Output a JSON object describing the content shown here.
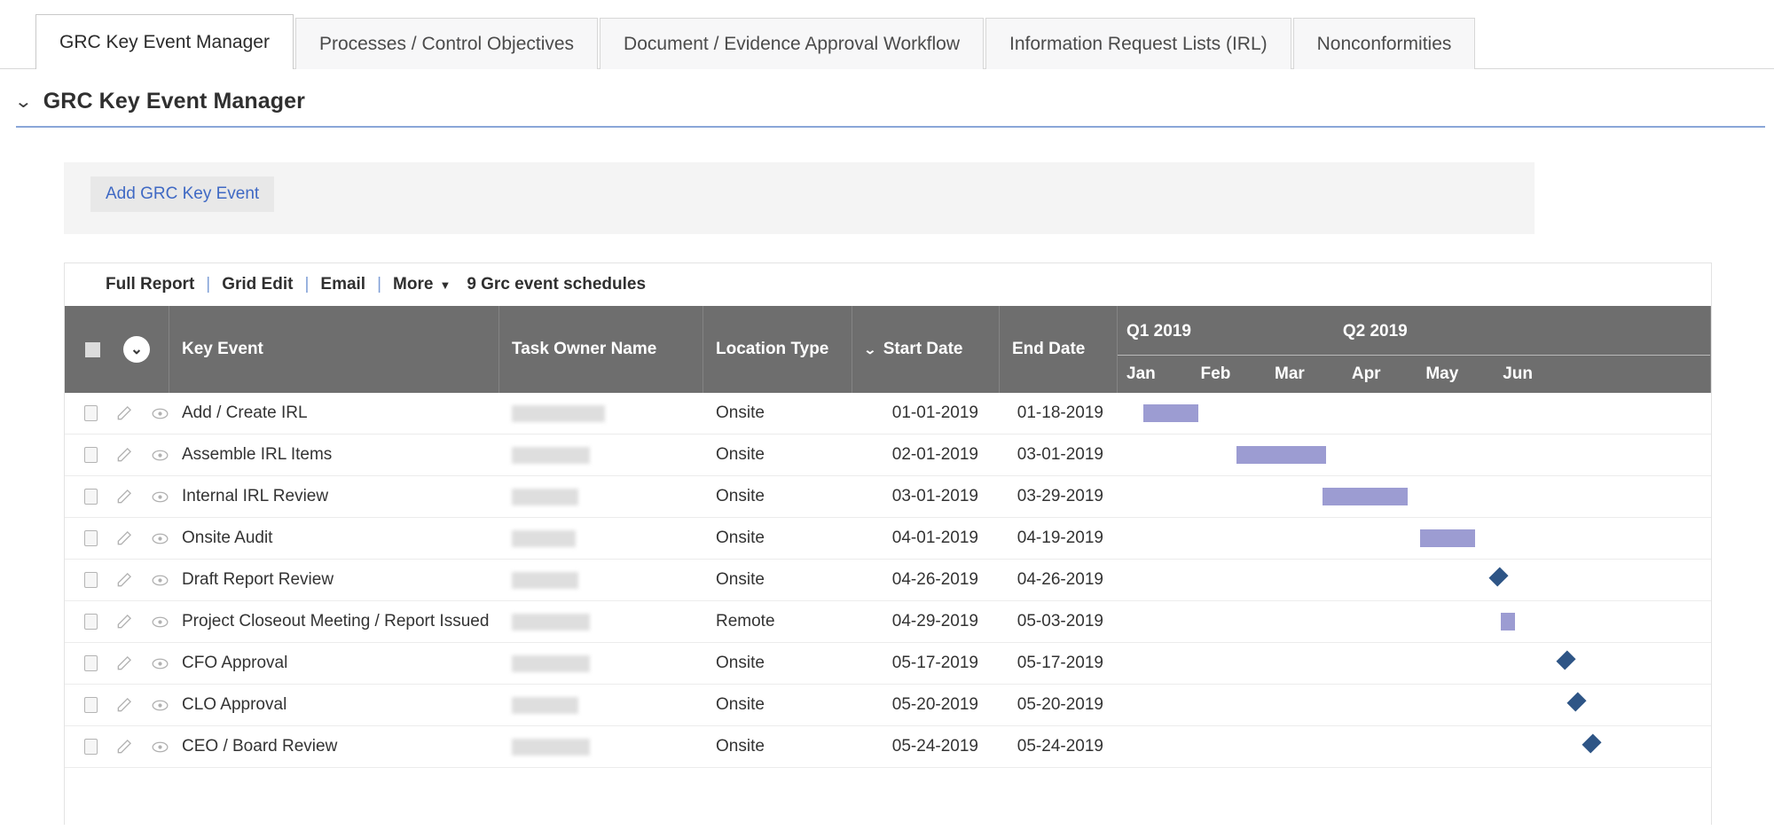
{
  "tabs": [
    {
      "label": "GRC Key Event Manager",
      "active": true
    },
    {
      "label": "Processes / Control Objectives",
      "active": false
    },
    {
      "label": "Document / Evidence Approval Workflow",
      "active": false
    },
    {
      "label": "Information Request Lists (IRL)",
      "active": false
    },
    {
      "label": "Nonconformities",
      "active": false
    }
  ],
  "section": {
    "title": "GRC Key Event Manager",
    "collapse_icon": "chevron-down-icon"
  },
  "add_panel": {
    "button_label": "Add  GRC Key Event"
  },
  "toolbar": {
    "full_report": "Full Report",
    "grid_edit": "Grid Edit",
    "email": "Email",
    "more": "More",
    "more_caret": "▼",
    "separator": "|",
    "record_count": "9 Grc event schedules"
  },
  "grid": {
    "header": {
      "select_all_icon": "checkbox-icon",
      "menu_icon": "chevron-down-circle-icon",
      "key_event": "Key Event",
      "task_owner_name": "Task Owner Name",
      "location_type": "Location Type",
      "start_date": "Start Date",
      "start_date_sort_icon": "sort-chevron-down-icon",
      "end_date": "End Date"
    },
    "rows": [
      {
        "key_event": "Add / Create IRL",
        "task_owner_name": "",
        "location_type": "Onsite",
        "start_date": "01-01-2019",
        "end_date": "01-18-2019"
      },
      {
        "key_event": "Assemble IRL Items",
        "task_owner_name": "",
        "location_type": "Onsite",
        "start_date": "02-01-2019",
        "end_date": "03-01-2019"
      },
      {
        "key_event": "Internal IRL Review",
        "task_owner_name": "",
        "location_type": "Onsite",
        "start_date": "03-01-2019",
        "end_date": "03-29-2019"
      },
      {
        "key_event": "Onsite Audit",
        "task_owner_name": "",
        "location_type": "Onsite",
        "start_date": "04-01-2019",
        "end_date": "04-19-2019"
      },
      {
        "key_event": "Draft Report Review",
        "task_owner_name": "",
        "location_type": "Onsite",
        "start_date": "04-26-2019",
        "end_date": "04-26-2019"
      },
      {
        "key_event": "Project Closeout Meeting / Report Issued",
        "task_owner_name": "",
        "location_type": "Remote",
        "start_date": "04-29-2019",
        "end_date": "05-03-2019"
      },
      {
        "key_event": "CFO Approval",
        "task_owner_name": "",
        "location_type": "Onsite",
        "start_date": "05-17-2019",
        "end_date": "05-17-2019"
      },
      {
        "key_event": "CLO Approval",
        "task_owner_name": "",
        "location_type": "Onsite",
        "start_date": "05-20-2019",
        "end_date": "05-20-2019"
      },
      {
        "key_event": "CEO / Board Review",
        "task_owner_name": "",
        "location_type": "Onsite",
        "start_date": "05-24-2019",
        "end_date": "05-24-2019"
      }
    ]
  },
  "chart_data": {
    "type": "bar",
    "title": "GRC Key Event Manager Gantt Timeline",
    "subtitle": "",
    "xlabel": "",
    "ylabel": "",
    "grid": false,
    "legend_position": "none",
    "quarters": [
      {
        "label": "Q1 2019",
        "left_pct": 1.5
      },
      {
        "label": "Q2 2019",
        "left_pct": 38.0
      }
    ],
    "months": [
      {
        "label": "Jan",
        "left_pct": 1.5
      },
      {
        "label": "Feb",
        "left_pct": 14.0
      },
      {
        "label": "Mar",
        "left_pct": 26.5
      },
      {
        "label": "Apr",
        "left_pct": 39.5
      },
      {
        "label": "May",
        "left_pct": 52.0
      },
      {
        "label": "Jun",
        "left_pct": 65.0
      }
    ],
    "axis_range": [
      "2019-01-01",
      "2019-06-30"
    ],
    "bars": [
      {
        "task": "Add / Create IRL",
        "start": "01-01-2019",
        "end": "01-18-2019",
        "shape": "bar",
        "left_pct": 4.3,
        "width_pct": 9.3,
        "color": "#9c9cd2"
      },
      {
        "task": "Assemble IRL Items",
        "start": "02-01-2019",
        "end": "03-01-2019",
        "shape": "bar",
        "left_pct": 20.0,
        "width_pct": 15.2,
        "color": "#9c9cd2"
      },
      {
        "task": "Internal IRL Review",
        "start": "03-01-2019",
        "end": "03-29-2019",
        "shape": "bar",
        "left_pct": 34.6,
        "width_pct": 14.3,
        "color": "#9c9cd2"
      },
      {
        "task": "Onsite Audit",
        "start": "04-01-2019",
        "end": "04-19-2019",
        "shape": "bar",
        "left_pct": 50.9,
        "width_pct": 9.4,
        "color": "#9c9cd2"
      },
      {
        "task": "Draft Report Review",
        "start": "04-26-2019",
        "end": "04-26-2019",
        "shape": "milestone",
        "left_pct": 63.1,
        "width_pct": 0,
        "color": "#2e5586"
      },
      {
        "task": "Project Closeout Meeting / Report Issued",
        "start": "04-29-2019",
        "end": "05-03-2019",
        "shape": "bar",
        "left_pct": 64.5,
        "width_pct": 2.4,
        "color": "#9c9cd2"
      },
      {
        "task": "CFO Approval",
        "start": "05-17-2019",
        "end": "05-17-2019",
        "shape": "milestone",
        "left_pct": 74.5,
        "width_pct": 0,
        "color": "#2e5586"
      },
      {
        "task": "CLO Approval",
        "start": "05-20-2019",
        "end": "05-20-2019",
        "shape": "milestone",
        "left_pct": 76.3,
        "width_pct": 0,
        "color": "#2e5586"
      },
      {
        "task": "CEO / Board Review",
        "start": "05-24-2019",
        "end": "05-24-2019",
        "shape": "milestone",
        "left_pct": 78.7,
        "width_pct": 0,
        "color": "#2e5586"
      }
    ]
  },
  "colors": {
    "bar": "#9c9cd2",
    "milestone": "#2e5586",
    "header_bg": "#6e6e6e",
    "accent_rule": "#8aa6d8",
    "link": "#3f69c4"
  },
  "redaction_widths": [
    105,
    88,
    75,
    72,
    75,
    88,
    88,
    75,
    88
  ]
}
